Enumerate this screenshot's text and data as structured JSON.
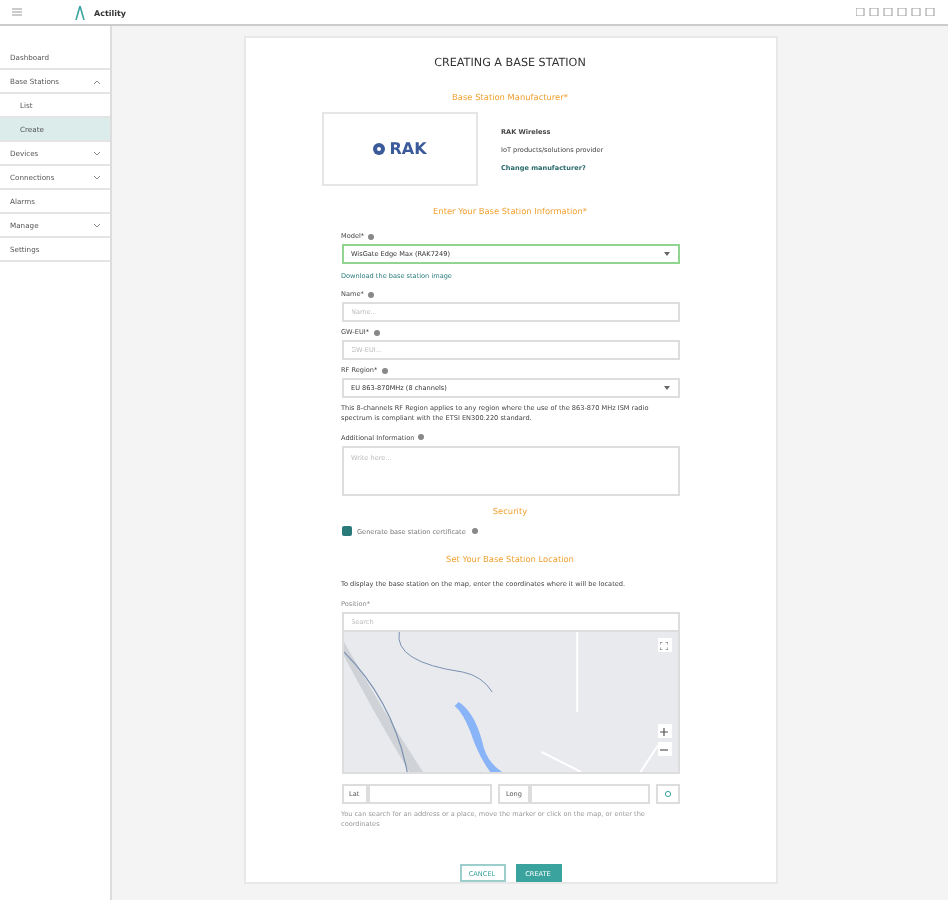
{
  "app": {
    "name": "Actility"
  },
  "sidebar": {
    "items": [
      {
        "label": "Dashboard",
        "selected": false
      },
      {
        "label": "Base Stations",
        "selected": false,
        "expanded": true,
        "children": [
          {
            "label": "List",
            "selected": false
          },
          {
            "label": "Create",
            "selected": true
          }
        ]
      },
      {
        "label": "Devices",
        "selected": false,
        "expanded": false
      },
      {
        "label": "Connections",
        "selected": false,
        "expanded": false
      },
      {
        "label": "Alarms",
        "selected": false
      },
      {
        "label": "Manage",
        "selected": false,
        "expanded": false
      },
      {
        "label": "Settings",
        "selected": false
      }
    ]
  },
  "form": {
    "title": "CREATING A BASE STATION",
    "manufacturer_heading": "Base Station Manufacturer*",
    "manufacturer": {
      "logo": "RAK",
      "name": "RAK Wireless",
      "description": "IoT products/solutions provider",
      "change_link": "Change manufacturer?"
    },
    "info_heading": "Enter Your Base Station Information*",
    "model": {
      "label": "Model*",
      "value": "WisGate Edge Max (RAK7249)"
    },
    "download_link": "Download the base station image",
    "name": {
      "label": "Name*",
      "placeholder": "Name..."
    },
    "eui": {
      "label": "GW-EUI*",
      "placeholder": "GW-EUI..."
    },
    "rf_region": {
      "label": "RF Region*",
      "value": "EU 863-870MHz (8 channels)",
      "note": "This 8-channels RF Region applies to any region where the use of the 863-870 MHz ISM radio spectrum is compliant with the ETSI EN300.220 standard."
    },
    "additional": {
      "label": "Additional Information",
      "placeholder": "Write here..."
    },
    "security_heading": "Security",
    "certificate": {
      "label": "Generate base station certificate",
      "checked": true
    },
    "location_heading": "Set Your Base Station Location",
    "location_note": "To display the base station on the map, enter the coordinates where it will be located.",
    "position": {
      "label": "Position*",
      "placeholder": "Search"
    },
    "lat": {
      "label": "Lat"
    },
    "long": {
      "label": "Long"
    },
    "location_help": "You can search for an address or a place, move the marker or click on the map, or enter the coordinates",
    "buttons": [
      {
        "label": "CANCEL",
        "kind": "secondary"
      },
      {
        "label": "CREATE",
        "kind": "primary"
      }
    ]
  }
}
